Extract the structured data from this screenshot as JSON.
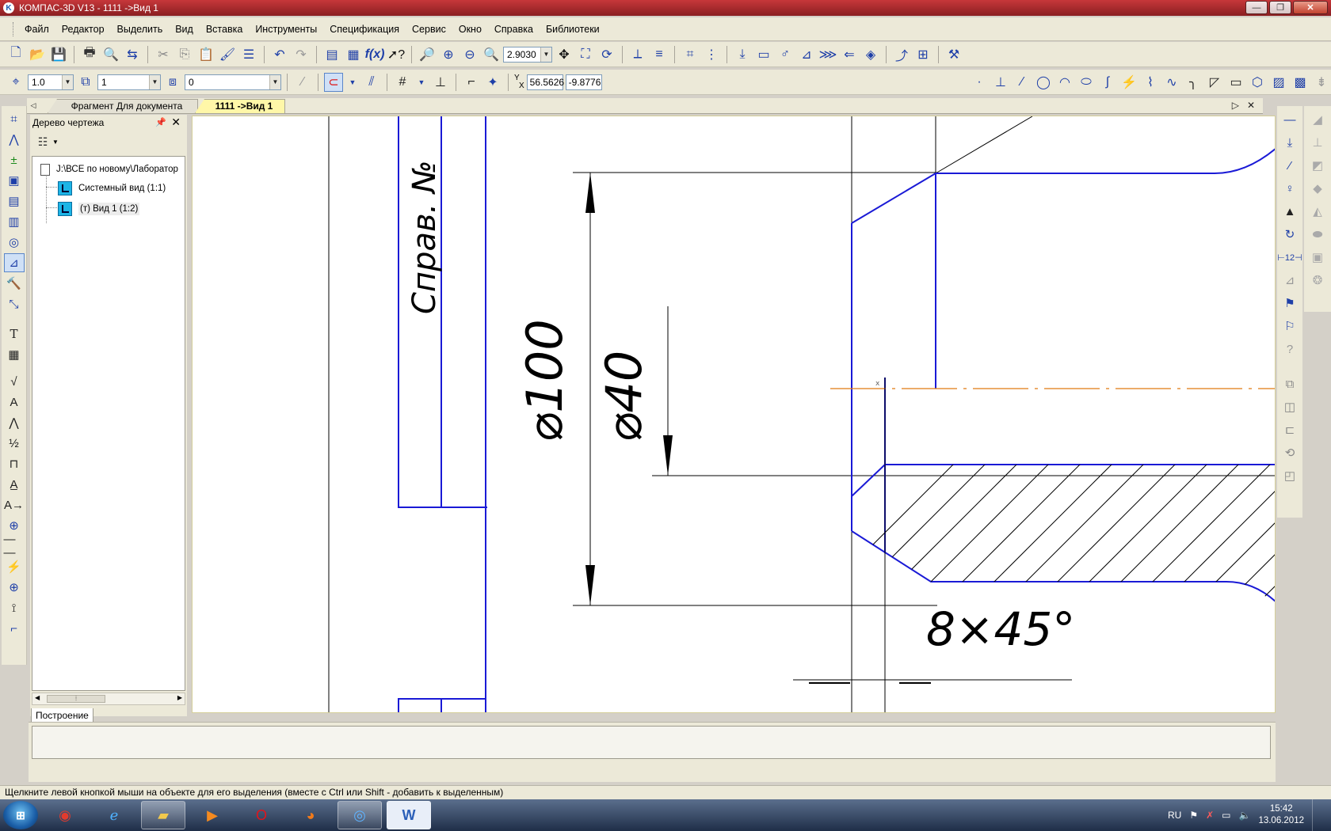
{
  "window": {
    "title": "КОМПАС-3D V13 - 1111 ->Вид 1",
    "controls": {
      "minimize": "—",
      "maximize": "❐",
      "close": "✕"
    }
  },
  "menu": {
    "items": [
      {
        "label": "Файл"
      },
      {
        "label": "Редактор"
      },
      {
        "label": "Выделить"
      },
      {
        "label": "Вид"
      },
      {
        "label": "Вставка"
      },
      {
        "label": "Инструменты"
      },
      {
        "label": "Спецификация"
      },
      {
        "label": "Сервис"
      },
      {
        "label": "Окно"
      },
      {
        "label": "Справка"
      },
      {
        "label": "Библиотеки"
      }
    ]
  },
  "toolbar": {
    "zoom_value": "2.9030",
    "line_style_value": "1.0",
    "layer_value": "1",
    "state_value": "0",
    "coord_x": "56.5626",
    "coord_y": "-9.8776",
    "coord_label_y": "Y",
    "coord_label_x": "X"
  },
  "tabs": [
    {
      "label": "Фрагмент Для документа",
      "active": false
    },
    {
      "label": "1111 ->Вид 1",
      "active": true
    }
  ],
  "tree": {
    "title": "Дерево чертежа",
    "root": "J:\\ВСЕ по новому\\Лаборатор",
    "nodes": [
      {
        "label": "Системный вид (1:1)"
      },
      {
        "label": "(т) Вид 1 (1:2)"
      }
    ],
    "bottom_tab": "Построение"
  },
  "drawing": {
    "stamp_text": "Справ. №",
    "dim_large": "⌀100",
    "dim_small": "⌀40",
    "chamfer": "8×45°",
    "line_color": "#1a1ad6",
    "axis_color": "#e07a10"
  },
  "status": {
    "hint": "Щелкните левой кнопкой мыши на объекте для его выделения (вместе с Ctrl или Shift - добавить к выделенным)"
  },
  "taskbar": {
    "lang": "RU",
    "time": "15:42",
    "date": "13.06.2012",
    "apps": [
      "chrome-icon",
      "ie-icon",
      "explorer-icon",
      "media-icon",
      "opera-icon",
      "firefox-icon",
      "kompas-icon",
      "word-icon"
    ]
  }
}
